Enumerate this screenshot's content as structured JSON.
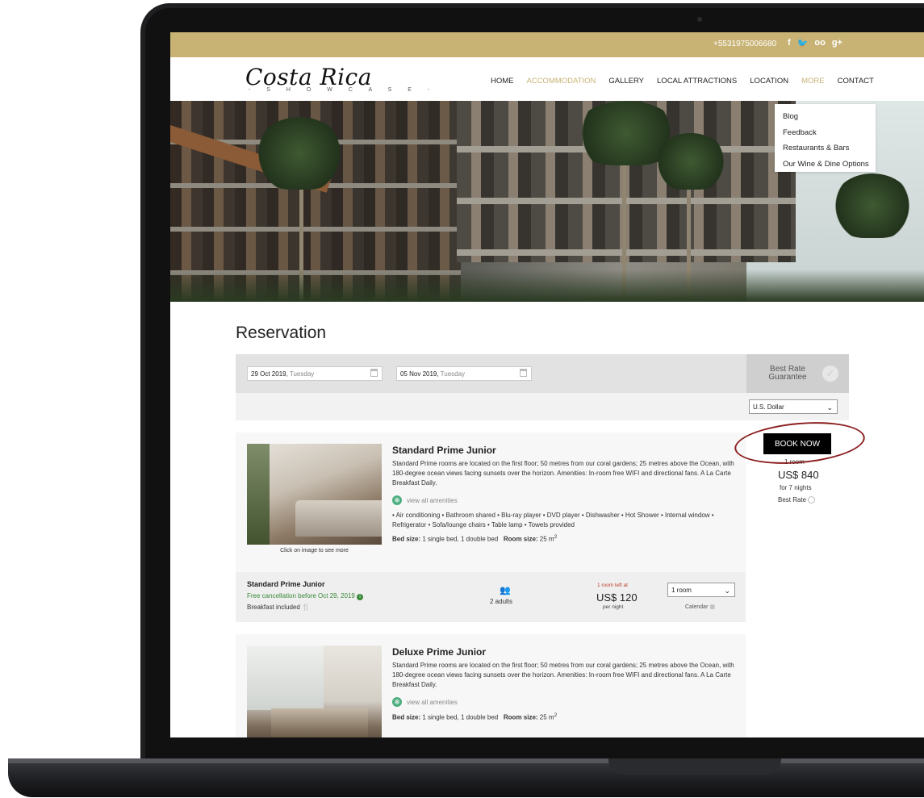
{
  "topbar": {
    "phone": "+5531975006680",
    "social": [
      "f",
      "t",
      "oo",
      "g+"
    ]
  },
  "logo": {
    "main": "Costa Rica",
    "sub": "- S H O W C A S E -"
  },
  "nav": {
    "items": [
      "HOME",
      "ACCOMMODATION",
      "GALLERY",
      "LOCAL ATTRACTIONS",
      "LOCATION",
      "MORE",
      "CONTACT"
    ],
    "active": "ACCOMMODATION"
  },
  "dropdown": {
    "items": [
      "Blog",
      "Feedback",
      "Restaurants & Bars",
      "Our Wine & Dine Options"
    ]
  },
  "reservation": {
    "title": "Reservation",
    "checkin": {
      "date": "29 Oct 2019,",
      "day": "Tuesday"
    },
    "checkout": {
      "date": "05 Nov 2019,",
      "day": "Tuesday"
    },
    "best_rate": "Best Rate Guarantee",
    "currency": "U.S. Dollar"
  },
  "rooms": [
    {
      "title": "Standard Prime Junior",
      "desc": "Standard Prime rooms are located on the first floor; 50 metres from our coral gardens; 25 metres above the Ocean, with 180-degree ocean views facing sunsets over the horizon. Amenities: In-room free WIFI and directional fans. A La Carte Breakfast Daily.",
      "amen_link": "view all amenities",
      "amenities": "• Air conditioning • Bathroom shared • Blu-ray player • DVD player • Dishwasher • Hot Shower • Internal window • Refrigerator • Sofa/lounge chairs • Table lamp • Towels provided",
      "bed_label": "Bed size:",
      "bed": "1 single bed, 1 double bed",
      "size_label": "Room size:",
      "size": "25 m",
      "size_sup": "2",
      "caption": "Click on image to see more"
    },
    {
      "title": "Deluxe Prime Junior",
      "desc": "Standard Prime rooms are located on the first floor; 50 metres from our coral gardens; 25 metres above the Ocean, with 180-degree ocean views facing sunsets over the horizon. Amenities: In-room free WIFI and directional fans. A La Carte Breakfast Daily.",
      "amen_link": "view all amenities",
      "bed_label": "Bed size:",
      "bed": "1 single bed, 1 double bed",
      "size_label": "Room size:",
      "size": "25 m",
      "size_sup": "2"
    }
  ],
  "rate": {
    "name": "Standard Prime Junior",
    "free_cancel": "Free cancellation before Oct 29, 2019",
    "breakfast": "Breakfast included",
    "adults": "2 adults",
    "left": "1 room left at",
    "price": "US$ 120",
    "per_night": "per night",
    "room_select": "1 room",
    "calendar": "Calendar"
  },
  "summary": {
    "book": "BOOK NOW",
    "rooms": "1 room",
    "total": "US$ 840",
    "nights": "for 7 nights",
    "best_rate": "Best Rate"
  },
  "colors": {
    "gold": "#c8b375",
    "green": "#3a8a3a",
    "red": "#c0392b",
    "circle": "#8b1e1e"
  }
}
